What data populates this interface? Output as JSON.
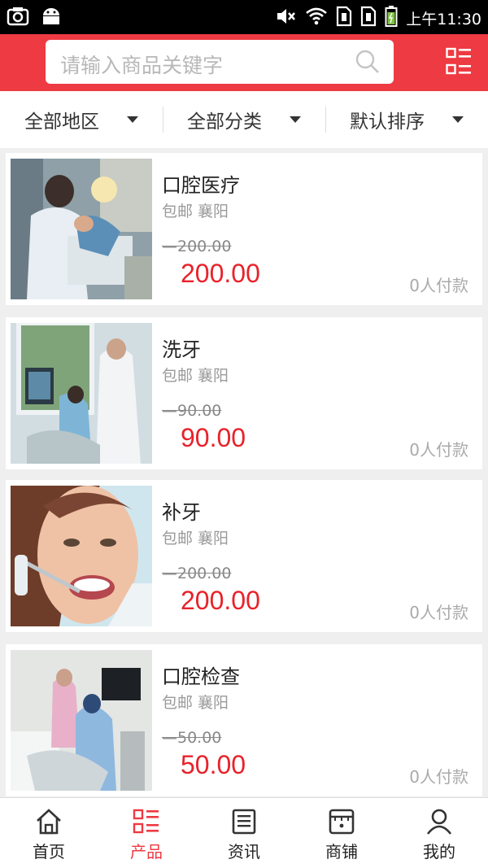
{
  "status_bar": {
    "time": "上午11:30",
    "left_icons": [
      "screenshot-icon",
      "android-icon"
    ],
    "right_icons": [
      "mute-icon",
      "wifi-icon",
      "sim1-icon",
      "sim2-icon",
      "battery-icon"
    ]
  },
  "header": {
    "search_placeholder": "请输入商品关键字",
    "accent_color": "#ee3a42"
  },
  "filters": [
    {
      "label": "全部地区"
    },
    {
      "label": "全部分类"
    },
    {
      "label": "默认排序"
    }
  ],
  "products": [
    {
      "name": "口腔医疗",
      "tags": "包邮 襄阳",
      "original_price": "200.00",
      "price": "200.00",
      "paid": "0人付款",
      "image": "dental-treatment-photo"
    },
    {
      "name": "洗牙",
      "tags": "包邮 襄阳",
      "original_price": "90.00",
      "price": "90.00",
      "paid": "0人付款",
      "image": "teeth-cleaning-photo"
    },
    {
      "name": "补牙",
      "tags": "包邮 襄阳",
      "original_price": "200.00",
      "price": "200.00",
      "paid": "0人付款",
      "image": "tooth-filling-photo"
    },
    {
      "name": "口腔检查",
      "tags": "包邮 襄阳",
      "original_price": "50.00",
      "price": "50.00",
      "paid": "0人付款",
      "image": "oral-exam-photo"
    }
  ],
  "bottom_nav": [
    {
      "label": "首页",
      "icon": "home-icon",
      "active": false
    },
    {
      "label": "产品",
      "icon": "product-grid-icon",
      "active": true
    },
    {
      "label": "资讯",
      "icon": "news-icon",
      "active": false
    },
    {
      "label": "商铺",
      "icon": "shop-icon",
      "active": false
    },
    {
      "label": "我的",
      "icon": "user-icon",
      "active": false
    }
  ]
}
